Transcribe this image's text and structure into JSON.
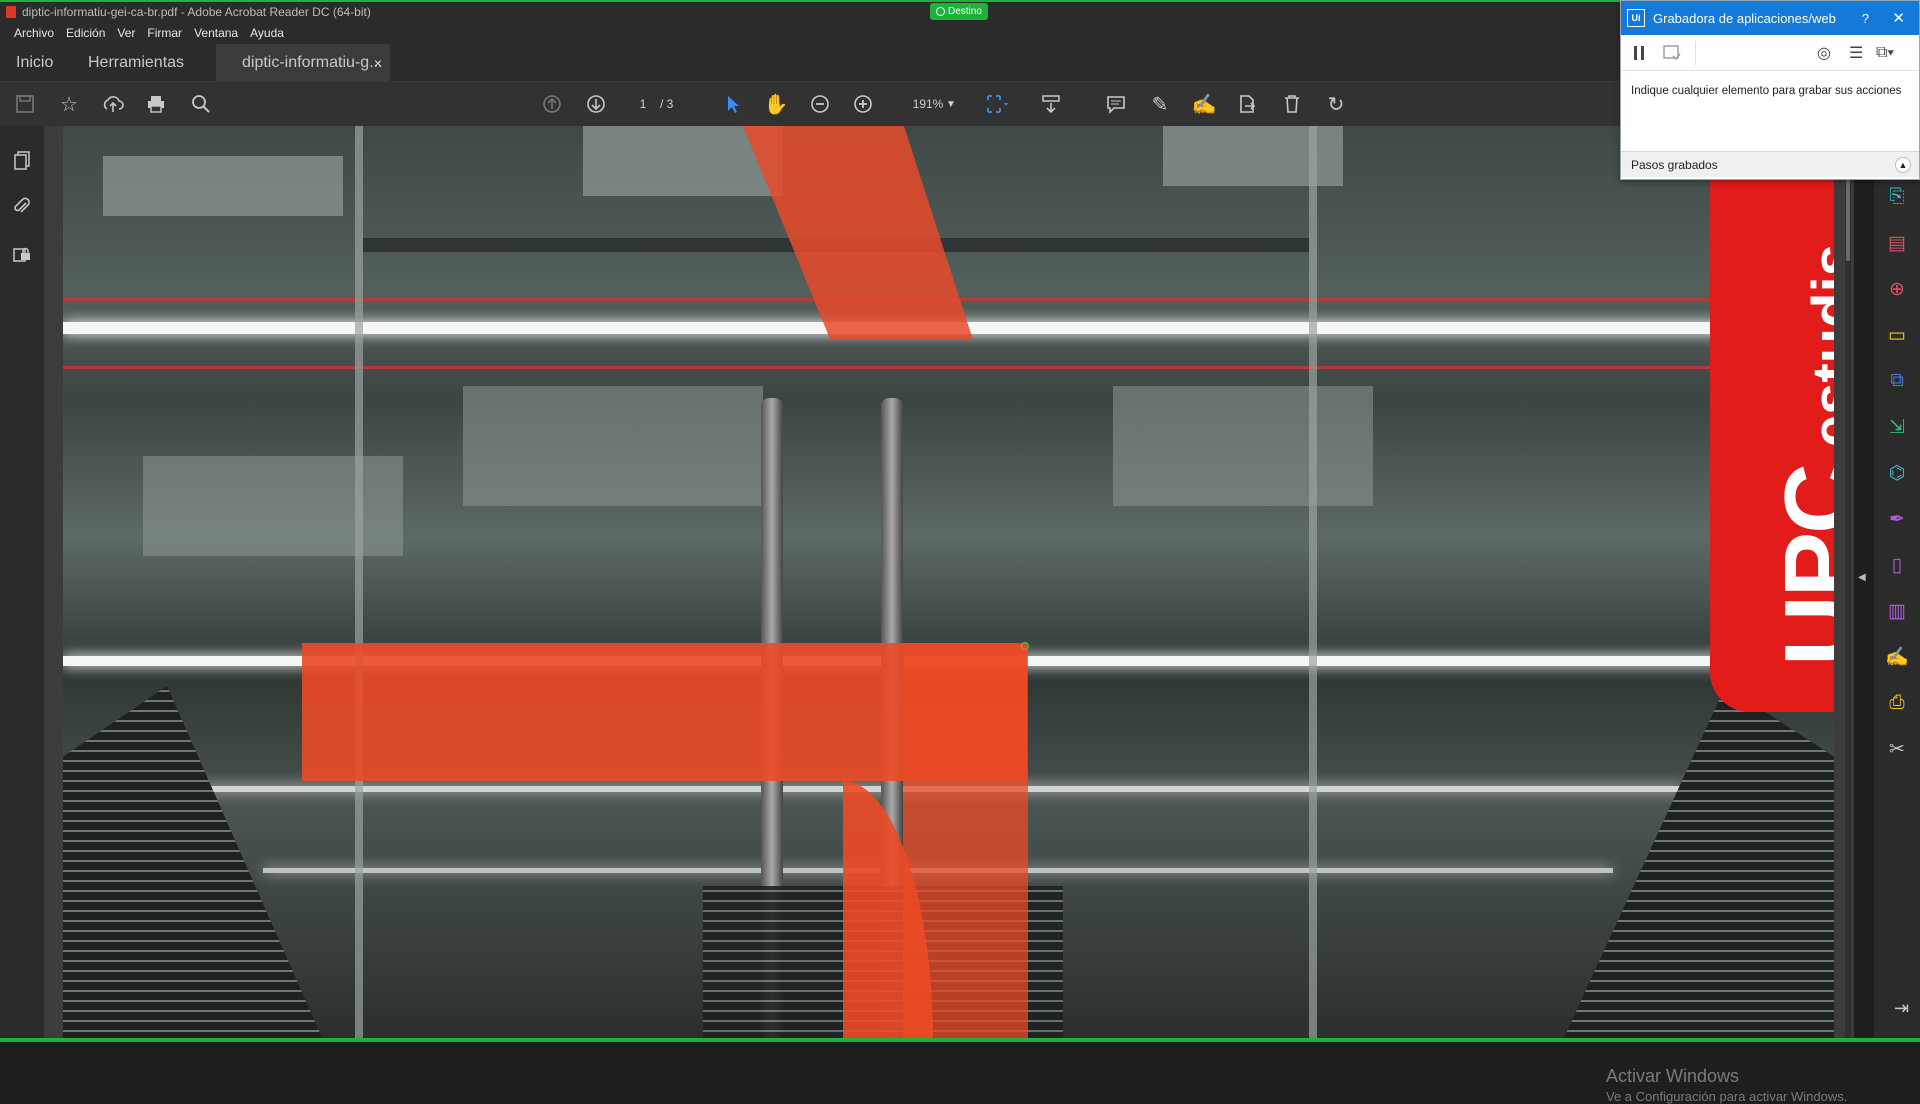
{
  "window": {
    "title": "diptic-informatiu-gei-ca-br.pdf - Adobe Acrobat Reader DC (64-bit)",
    "destination_badge": "Destino"
  },
  "menu": [
    "Archivo",
    "Edición",
    "Ver",
    "Firmar",
    "Ventana",
    "Ayuda"
  ],
  "tabs": {
    "home": "Inicio",
    "tools": "Herramientas",
    "document": "diptic-informatiu-g...",
    "close_glyph": "×"
  },
  "toolbar": {
    "current_page": "1",
    "page_total": "/ 3",
    "zoom": "191%"
  },
  "document": {
    "upc_label": "UPC",
    "estudis_label": "estudis"
  },
  "watermark": {
    "line1": "Activar Windows",
    "line2": "Ve a Configuración para activar Windows."
  },
  "recorder": {
    "title": "Grabadora de aplicaciones/web",
    "help": "?",
    "close": "✕",
    "message": "Indique cualquier elemento para grabar sus acciones",
    "steps_label": "Pasos grabados"
  },
  "colors": {
    "accent_green": "#1db33a",
    "recorder_blue": "#1479d8",
    "upc_red": "#e21b1b",
    "overlay_orange": "#ec4a26"
  }
}
